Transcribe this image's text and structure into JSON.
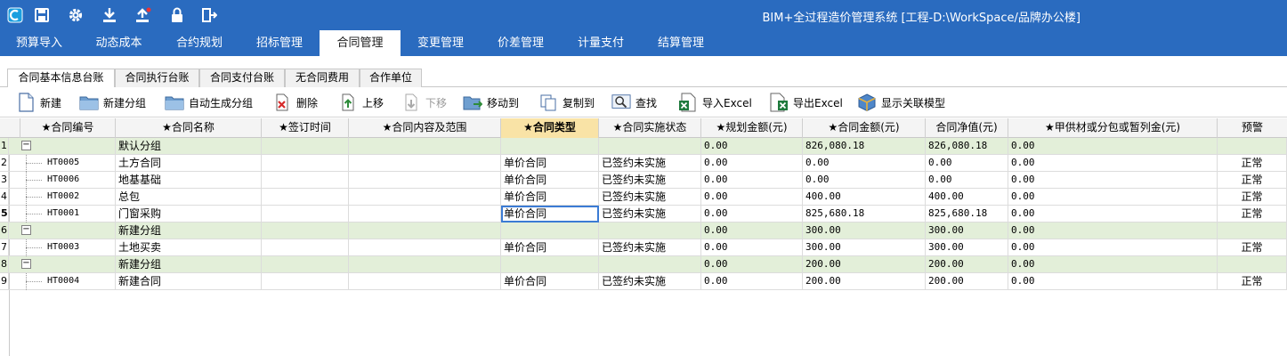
{
  "app": {
    "title": "BIM+全过程造价管理系统 [工程-D:\\WorkSpace/品牌办公楼]"
  },
  "quick_access": [
    {
      "name": "app-logo-icon"
    },
    {
      "name": "save-icon"
    },
    {
      "name": "settings-gear-icon"
    },
    {
      "name": "download-icon"
    },
    {
      "name": "upload-icon"
    },
    {
      "name": "lock-icon"
    },
    {
      "name": "exit-icon"
    }
  ],
  "menu": {
    "items": [
      {
        "label": "预算导入"
      },
      {
        "label": "动态成本"
      },
      {
        "label": "合约规划"
      },
      {
        "label": "招标管理"
      },
      {
        "label": "合同管理"
      },
      {
        "label": "变更管理"
      },
      {
        "label": "价差管理"
      },
      {
        "label": "计量支付"
      },
      {
        "label": "结算管理"
      }
    ],
    "active": "合同管理"
  },
  "subtabs": {
    "items": [
      {
        "label": "合同基本信息台账"
      },
      {
        "label": "合同执行台账"
      },
      {
        "label": "合同支付台账"
      },
      {
        "label": "无合同费用"
      },
      {
        "label": "合作单位"
      }
    ],
    "active": "合同基本信息台账"
  },
  "toolbar": {
    "new": "新建",
    "new_group": "新建分组",
    "auto_group": "自动生成分组",
    "delete": "删除",
    "move_up": "上移",
    "move_down": "下移",
    "move_to": "移动到",
    "copy_to": "复制到",
    "find": "查找",
    "import_excel": "导入Excel",
    "export_excel": "导出Excel",
    "show_model": "显示关联模型"
  },
  "grid": {
    "headers": {
      "code": "★合同编号",
      "name": "★合同名称",
      "sign_time": "★签订时间",
      "scope": "★合同内容及范围",
      "type": "★合同类型",
      "status": "★合同实施状态",
      "planned": "★规划金额(元)",
      "amount": "★合同金额(元)",
      "net": "合同净值(元)",
      "supply": "★甲供材或分包或暂列金(元)",
      "warn": "预警"
    },
    "rows": [
      {
        "num": "1",
        "group": true,
        "code": "",
        "name": "默认分组",
        "type": "",
        "status": "",
        "planned": "0.00",
        "amount": "826,080.18",
        "net": "826,080.18",
        "supply": "0.00",
        "warn": ""
      },
      {
        "num": "2",
        "group": false,
        "code": "HT0005",
        "name": "土方合同",
        "type": "单价合同",
        "status": "已签约未实施",
        "planned": "0.00",
        "amount": "0.00",
        "net": "0.00",
        "supply": "0.00",
        "warn": "正常"
      },
      {
        "num": "3",
        "group": false,
        "code": "HT0006",
        "name": "地基基础",
        "type": "单价合同",
        "status": "已签约未实施",
        "planned": "0.00",
        "amount": "0.00",
        "net": "0.00",
        "supply": "0.00",
        "warn": "正常"
      },
      {
        "num": "4",
        "group": false,
        "code": "HT0002",
        "name": "总包",
        "type": "单价合同",
        "status": "已签约未实施",
        "planned": "0.00",
        "amount": "400.00",
        "net": "400.00",
        "supply": "0.00",
        "warn": "正常"
      },
      {
        "num": "5",
        "group": false,
        "code": "HT0001",
        "name": "门窗采购",
        "type": "单价合同",
        "status": "已签约未实施",
        "planned": "0.00",
        "amount": "825,680.18",
        "net": "825,680.18",
        "supply": "0.00",
        "warn": "正常"
      },
      {
        "num": "6",
        "group": true,
        "code": "",
        "name": "新建分组",
        "type": "",
        "status": "",
        "planned": "0.00",
        "amount": "300.00",
        "net": "300.00",
        "supply": "0.00",
        "warn": ""
      },
      {
        "num": "7",
        "group": false,
        "code": "HT0003",
        "name": "土地买卖",
        "type": "单价合同",
        "status": "已签约未实施",
        "planned": "0.00",
        "amount": "300.00",
        "net": "300.00",
        "supply": "0.00",
        "warn": "正常"
      },
      {
        "num": "8",
        "group": true,
        "code": "",
        "name": "新建分组",
        "type": "",
        "status": "",
        "planned": "0.00",
        "amount": "200.00",
        "net": "200.00",
        "supply": "0.00",
        "warn": ""
      },
      {
        "num": "9",
        "group": false,
        "code": "HT0004",
        "name": "新建合同",
        "type": "单价合同",
        "status": "已签约未实施",
        "planned": "0.00",
        "amount": "200.00",
        "net": "200.00",
        "supply": "0.00",
        "warn": "正常"
      }
    ],
    "current_row": "5",
    "selected_cell": "type"
  },
  "colors": {
    "titlebar": "#2a6bbf",
    "group_row": "#e3efd9",
    "highlight_header": "#f9e3a6",
    "selection": "#3b7bd4"
  }
}
